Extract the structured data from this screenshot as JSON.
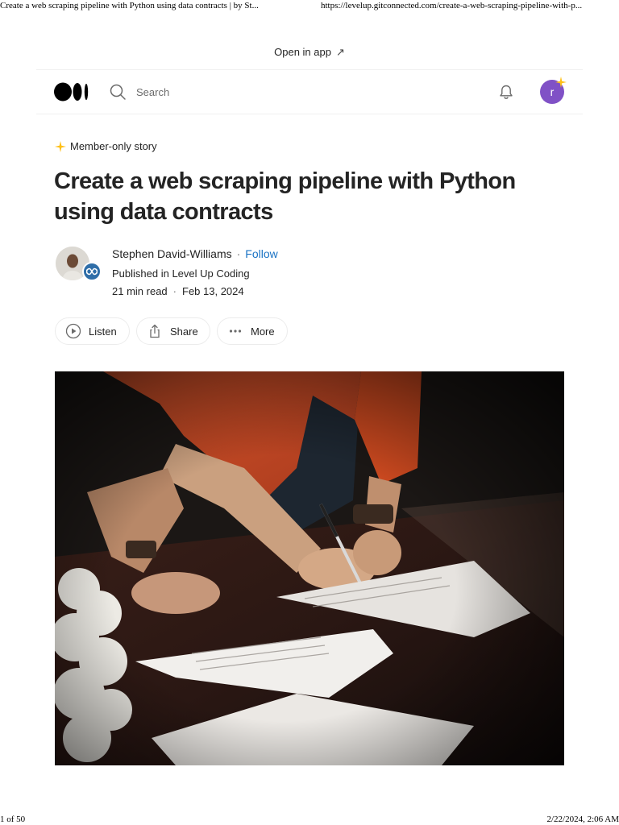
{
  "print_header": {
    "title": "Create a web scraping pipeline with Python using data contracts | by St...",
    "url": "https://levelup.gitconnected.com/create-a-web-scraping-pipeline-with-p..."
  },
  "open_in_app": {
    "label": "Open in app",
    "icon": "arrow-up-right-icon"
  },
  "topbar": {
    "logo": "medium-logo",
    "search": {
      "placeholder": "Search",
      "value": ""
    },
    "notifications_icon": "bell-icon",
    "user_avatar_initial": "r",
    "user_avatar_color": "#8051c6"
  },
  "article": {
    "badge": "Member-only story",
    "badge_color": "#ffc017",
    "title": "Create a web scraping pipeline with Python using data contracts",
    "author": "Stephen David-Williams",
    "follow_label": "Follow",
    "follow_color": "#1a73c4",
    "published_in": "Published in Level Up Coding",
    "read_time": "21 min read",
    "date": "Feb 13, 2024",
    "actions": [
      {
        "label": "Listen",
        "icon": "play-circle-icon"
      },
      {
        "label": "Share",
        "icon": "share-icon"
      },
      {
        "label": "More",
        "icon": "more-dots-icon"
      }
    ],
    "hero_image": "people-signing-documents-photo"
  },
  "print_footer": {
    "page": "1 of 50",
    "datetime": "2/22/2024, 2:06 AM"
  }
}
